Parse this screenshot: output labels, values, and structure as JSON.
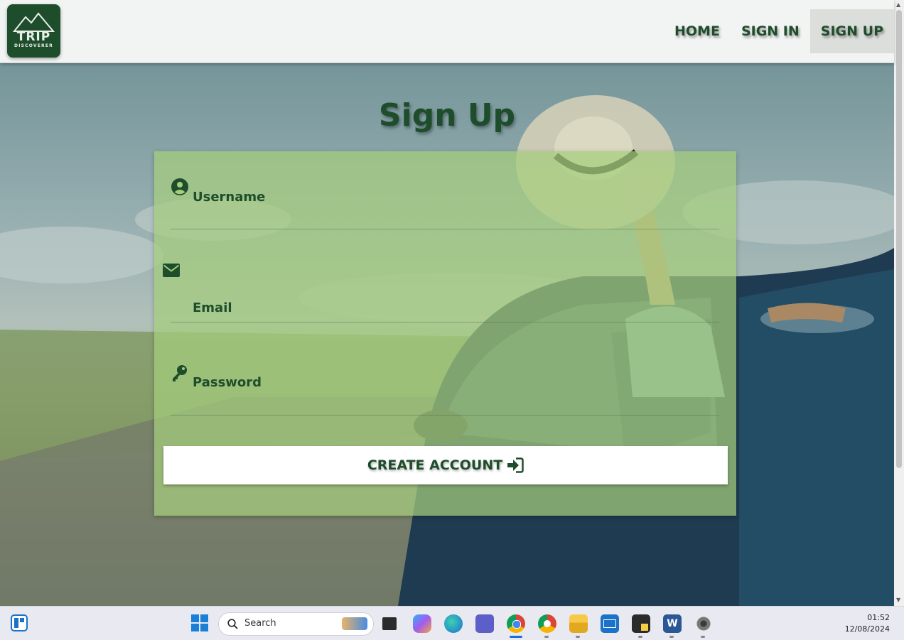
{
  "brand": {
    "logo_line1": "TRIP",
    "logo_line2": "DISCOVERER"
  },
  "nav": {
    "items": [
      "HOME",
      "SIGN IN",
      "SIGN UP"
    ],
    "active": "SIGN UP"
  },
  "form": {
    "title": "Sign Up",
    "fields": [
      {
        "label": "Username",
        "icon": "user-circle-icon"
      },
      {
        "label": "Email",
        "icon": "envelope-icon"
      },
      {
        "label": "Password",
        "icon": "key-icon"
      }
    ],
    "submit_label": "CREATE ACCOUNT",
    "submit_icon": "sign-in-icon"
  },
  "taskbar": {
    "search_placeholder": "Search",
    "apps": [
      "widgets-icon",
      "start-icon",
      "search-icon",
      "task-view-icon",
      "copilot-icon",
      "edge-icon",
      "teams-icon",
      "chrome-icon",
      "chrome-profile-icon",
      "file-explorer-icon",
      "mail-icon",
      "sticky-notes-icon",
      "word-icon",
      "settings-icon"
    ],
    "time": "01:52",
    "date": "12/08/2024"
  },
  "colors": {
    "brand_green": "#1e4d2b",
    "card_green": "#a5cd7d"
  }
}
